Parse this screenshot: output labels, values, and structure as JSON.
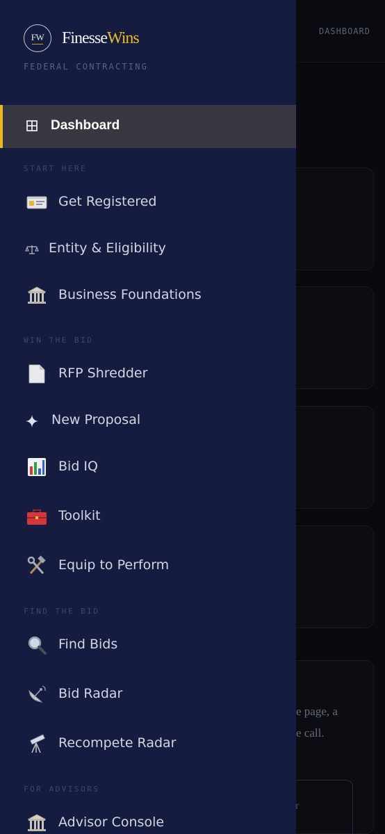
{
  "background": {
    "topbar_label": "DASHBOARD",
    "card_line_1": "e page, a",
    "card_line_2": "e call.",
    "button_text": "r"
  },
  "brand": {
    "monogram": "FW",
    "name_part1": "Finesse",
    "name_part2": "Wins",
    "subtitle": "FEDERAL CONTRACTING",
    "accent_color": "#e8b923"
  },
  "nav": {
    "active": {
      "label": "Dashboard",
      "icon": "grid-icon"
    },
    "sections": {
      "start_here": "START HERE",
      "win_the_bid": "WIN THE BID",
      "find_the_bid": "FIND THE BID",
      "for_advisors": "FOR ADVISORS"
    },
    "items": [
      {
        "label": "Get Registered",
        "icon": "id-card-icon"
      },
      {
        "label": "Entity & Eligibility",
        "icon": "scales-icon"
      },
      {
        "label": "Business Foundations",
        "icon": "bank-icon"
      },
      {
        "label": "RFP Shredder",
        "icon": "document-icon"
      },
      {
        "label": "New Proposal",
        "icon": "sparkle-icon"
      },
      {
        "label": "Bid IQ",
        "icon": "bar-chart-icon"
      },
      {
        "label": "Toolkit",
        "icon": "toolbox-icon"
      },
      {
        "label": "Equip to Perform",
        "icon": "hammer-wrench-icon"
      },
      {
        "label": "Find Bids",
        "icon": "magnifier-icon"
      },
      {
        "label": "Bid Radar",
        "icon": "satellite-dish-icon"
      },
      {
        "label": "Recompete Radar",
        "icon": "telescope-icon"
      },
      {
        "label": "Advisor Console",
        "icon": "bank-icon"
      }
    ]
  }
}
